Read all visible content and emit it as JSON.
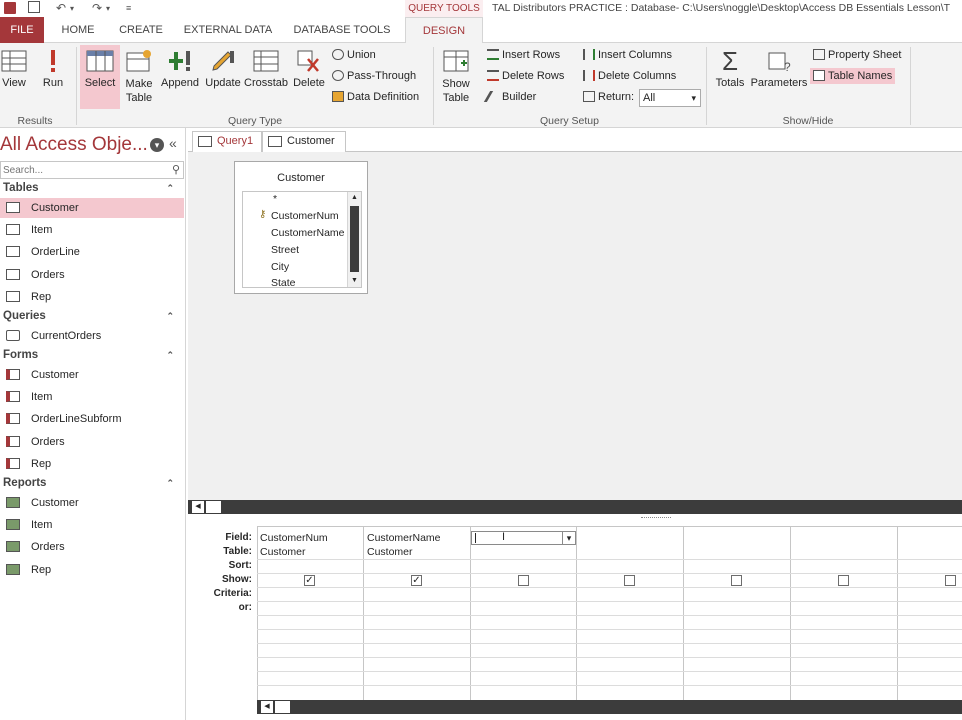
{
  "titlebar": {
    "context_tab": "QUERY TOOLS",
    "window_title": "TAL Distributors PRACTICE : Database- C:\\Users\\noggle\\Desktop\\Access DB Essentials Lesson\\T"
  },
  "tabs": [
    "FILE",
    "HOME",
    "CREATE",
    "EXTERNAL DATA",
    "DATABASE TOOLS",
    "DESIGN"
  ],
  "ribbon": {
    "results": {
      "label": "Results",
      "view": "View",
      "run": "Run"
    },
    "query_type": {
      "label": "Query Type",
      "select": "Select",
      "make_table": "Make Table",
      "append": "Append",
      "update": "Update",
      "crosstab": "Crosstab",
      "delete": "Delete",
      "union": "Union",
      "pass_through": "Pass-Through",
      "data_definition": "Data Definition"
    },
    "query_setup": {
      "label": "Query Setup",
      "show_table": "Show Table",
      "insert_rows": "Insert Rows",
      "delete_rows": "Delete Rows",
      "builder": "Builder",
      "insert_columns": "Insert Columns",
      "delete_columns": "Delete Columns",
      "return_label": "Return:",
      "return_value": "All"
    },
    "show_hide": {
      "label": "Show/Hide",
      "totals": "Totals",
      "parameters": "Parameters",
      "property_sheet": "Property Sheet",
      "table_names": "Table Names"
    }
  },
  "nav": {
    "title": "All Access Obje...",
    "search_placeholder": "Search...",
    "categories": {
      "tables": {
        "label": "Tables",
        "items": [
          "Customer",
          "Item",
          "OrderLine",
          "Orders",
          "Rep"
        ]
      },
      "queries": {
        "label": "Queries",
        "items": [
          "CurrentOrders"
        ]
      },
      "forms": {
        "label": "Forms",
        "items": [
          "Customer",
          "Item",
          "OrderLineSubform",
          "Orders",
          "Rep"
        ]
      },
      "reports": {
        "label": "Reports",
        "items": [
          "Customer",
          "Item",
          "Orders",
          "Rep"
        ]
      }
    }
  },
  "doc_tabs": [
    "Query1",
    "Customer"
  ],
  "field_list": {
    "title": "Customer",
    "fields": [
      "*",
      "CustomerNum",
      "CustomerName",
      "Street",
      "City",
      "State"
    ]
  },
  "grid": {
    "row_labels": [
      "Field:",
      "Table:",
      "Sort:",
      "Show:",
      "Criteria:",
      "or:"
    ],
    "columns": [
      {
        "field": "CustomerNum",
        "table": "Customer",
        "show": true
      },
      {
        "field": "CustomerName",
        "table": "Customer",
        "show": true
      },
      {
        "field": "",
        "table": "",
        "show": false
      },
      {
        "field": "",
        "table": "",
        "show": false
      },
      {
        "field": "",
        "table": "",
        "show": false
      },
      {
        "field": "",
        "table": "",
        "show": false
      },
      {
        "field": "",
        "table": "",
        "show": false
      }
    ]
  },
  "colors": {
    "accent": "#a4373a",
    "selected": "#f4c8cf",
    "ribbon_bg": "#f3f3f3"
  }
}
